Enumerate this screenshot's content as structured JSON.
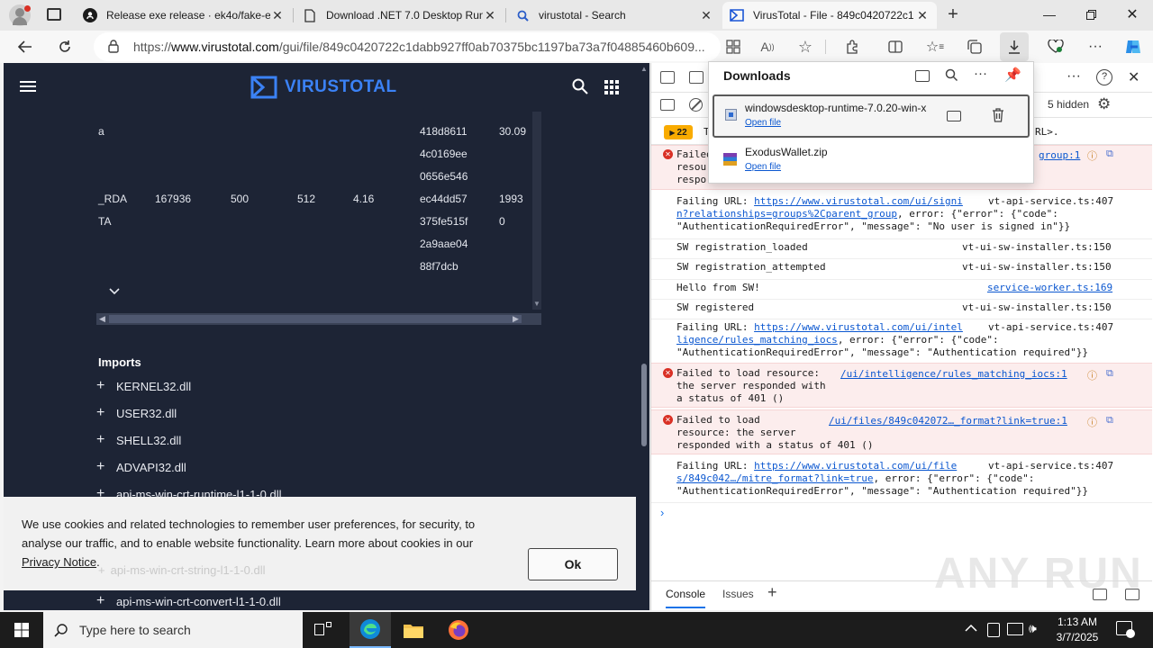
{
  "tabs": [
    {
      "icon": "github-icon",
      "label": "Release exe release · ek4o/fake-e"
    },
    {
      "icon": "document-icon",
      "label": "Download .NET 7.0 Desktop Runt"
    },
    {
      "icon": "search-icon",
      "label": "virustotal - Search"
    },
    {
      "icon": "virustotal-icon",
      "label": "VirusTotal - File - 849c0420722c1"
    }
  ],
  "address": {
    "prefix": "https://",
    "host": "www.virustotal.com",
    "path": "/gui/file/849c0420722c1dabb927ff0ab70375bc1197ba73a7f04885460b609..."
  },
  "vt": {
    "brand": "VIRUSTOTAL",
    "section_rows": [
      {
        "name": "a",
        "vsize": "",
        "vaddr": "",
        "rsize": "",
        "entropy": "",
        "md5": "418d8611",
        "chi": "30.09"
      },
      {
        "name": "",
        "vsize": "",
        "vaddr": "",
        "rsize": "",
        "entropy": "",
        "md5": "4c0169ee",
        "chi": ""
      },
      {
        "name": "",
        "vsize": "",
        "vaddr": "",
        "rsize": "",
        "entropy": "",
        "md5": "0656e546",
        "chi": ""
      },
      {
        "name": "_RDA",
        "vsize": "167936",
        "vaddr": "500",
        "rsize": "512",
        "entropy": "4.16",
        "md5": "ec44dd57",
        "chi": "1993"
      },
      {
        "name": "TA",
        "vsize": "",
        "vaddr": "",
        "rsize": "",
        "entropy": "",
        "md5": "375fe515f",
        "chi": "0"
      },
      {
        "name": "",
        "vsize": "",
        "vaddr": "",
        "rsize": "",
        "entropy": "",
        "md5": "2a9aae04",
        "chi": ""
      },
      {
        "name": "",
        "vsize": "",
        "vaddr": "",
        "rsize": "",
        "entropy": "",
        "md5": "88f7dcb",
        "chi": ""
      }
    ],
    "imports_title": "Imports",
    "imports": [
      "KERNEL32.dll",
      "USER32.dll",
      "SHELL32.dll",
      "ADVAPI32.dll",
      "api-ms-win-crt-runtime-l1-1-0.dll",
      "api-ms-win-crt-string-l1-1-0.dll",
      "api-ms-win-crt-convert-l1-1-0.dll"
    ],
    "cookie_text": "We use cookies and related technologies to remember user preferences, for security, to analyse our traffic, and to enable website functionality. Learn more about cookies in our",
    "cookie_link": "Privacy Notice",
    "cookie_period": ".",
    "cookie_ok": "Ok"
  },
  "devtools": {
    "badge_count": "22",
    "hidden_count": "5 hidden",
    "partial_top": "T",
    "partial_right": "RL>.",
    "logs": [
      {
        "type": "error-partial",
        "text": "Failed\nresou\nrespo",
        "src": "group:1"
      },
      {
        "type": "log",
        "text": "Failing URL: ",
        "link": "https://www.virustotal.com/ui/signi\nn?relationships=groups%2Cparent_group",
        "rest": ", error: {\"error\": {\"code\":\n\"AuthenticationRequiredError\", \"message\": \"No user is signed in\"}}",
        "src": "vt-api-service.ts:407"
      },
      {
        "type": "log",
        "text": "SW registration_loaded",
        "src": "vt-ui-sw-installer.ts:150"
      },
      {
        "type": "log",
        "text": "SW registration_attempted",
        "src": "vt-ui-sw-installer.ts:150"
      },
      {
        "type": "log",
        "text": "Hello from SW!",
        "src": "service-worker.ts:169"
      },
      {
        "type": "log",
        "text": "SW registered",
        "src": "vt-ui-sw-installer.ts:150"
      },
      {
        "type": "log",
        "text": "Failing URL: ",
        "link": "https://www.virustotal.com/ui/intel\nligence/rules_matching_iocs",
        "rest": ", error: {\"error\": {\"code\":\n\"AuthenticationRequiredError\", \"message\": \"Authentication required\"}}",
        "src": "vt-api-service.ts:407"
      },
      {
        "type": "error",
        "text": "Failed to load resource:\nthe server responded with\na status of 401 ()",
        "src": "/ui/intelligence/rules_matching_iocs:1"
      },
      {
        "type": "error",
        "text": "Failed to load\nresource: the server\nresponded with a status of 401 ()",
        "src": "/ui/files/849c042072…_format?link=true:1"
      },
      {
        "type": "log",
        "text": "Failing URL: ",
        "link": "https://www.virustotal.com/ui/file\ns/849c042…/mitre_format?link=true",
        "rest": ", error: {\"error\": {\"code\":\n\"AuthenticationRequiredError\", \"message\": \"Authentication required\"}}",
        "src": "vt-api-service.ts:407"
      }
    ],
    "bottom_tabs": [
      "Console",
      "Issues"
    ]
  },
  "downloads": {
    "title": "Downloads",
    "items": [
      {
        "name": "windowsdesktop-runtime-7.0.20-win-x",
        "action": "Open file"
      },
      {
        "name": "ExodusWallet.zip",
        "action": "Open file"
      }
    ]
  },
  "taskbar": {
    "search_placeholder": "Type here to search",
    "time": "1:13 AM",
    "date": "3/7/2025"
  },
  "watermark": "ANY RUN"
}
